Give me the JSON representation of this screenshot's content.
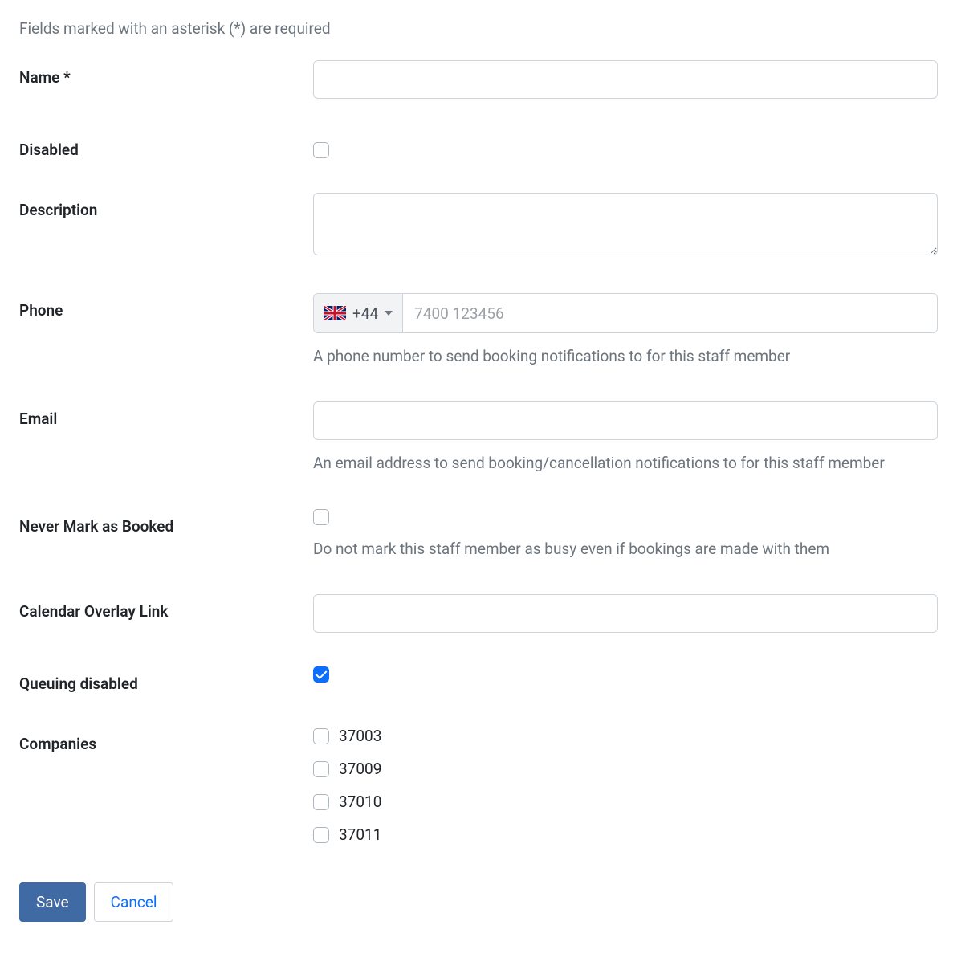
{
  "form_note": "Fields marked with an asterisk (*) are required",
  "fields": {
    "name": {
      "label": "Name *",
      "value": ""
    },
    "disabled": {
      "label": "Disabled",
      "checked": false
    },
    "description": {
      "label": "Description",
      "value": ""
    },
    "phone": {
      "label": "Phone",
      "prefix": "+44",
      "placeholder": "7400 123456",
      "value": "",
      "help": "A phone number to send booking notifications to for this staff member"
    },
    "email": {
      "label": "Email",
      "value": "",
      "help": "An email address to send booking/cancellation notifications to for this staff member"
    },
    "never_booked": {
      "label": "Never Mark as Booked",
      "checked": false,
      "help": "Do not mark this staff member as busy even if bookings are made with them"
    },
    "calendar_overlay": {
      "label": "Calendar Overlay Link",
      "value": ""
    },
    "queuing_disabled": {
      "label": "Queuing disabled",
      "checked": true
    },
    "companies": {
      "label": "Companies",
      "items": [
        {
          "label": "37003",
          "checked": false
        },
        {
          "label": "37009",
          "checked": false
        },
        {
          "label": "37010",
          "checked": false
        },
        {
          "label": "37011",
          "checked": false
        }
      ]
    }
  },
  "buttons": {
    "save": "Save",
    "cancel": "Cancel"
  }
}
